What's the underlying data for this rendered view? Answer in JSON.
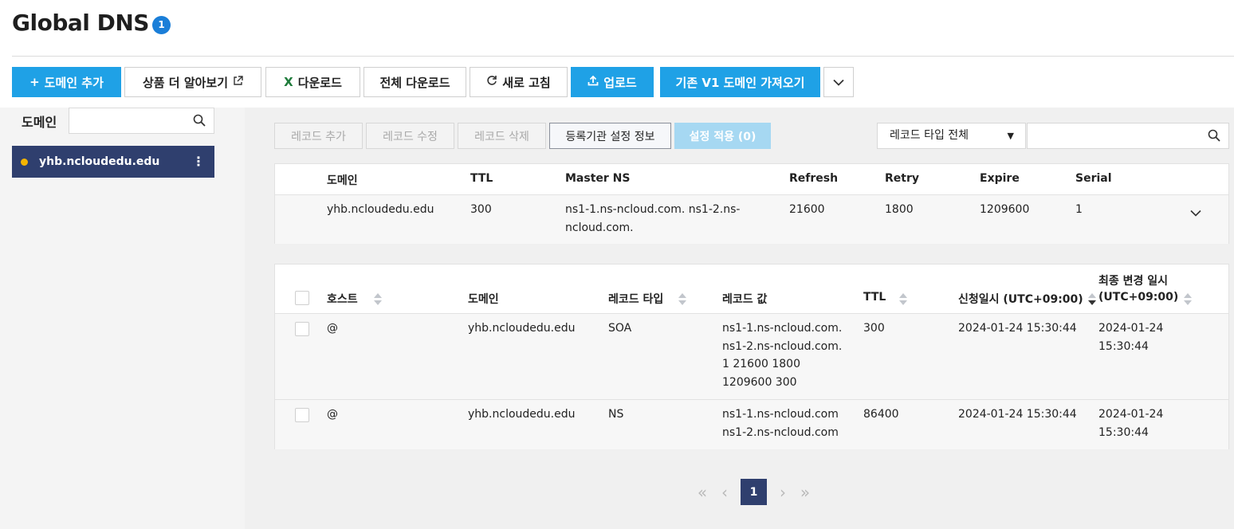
{
  "header": {
    "title": "Global DNS",
    "badge": "1"
  },
  "toolbar": {
    "add_domain": "도메인 추가",
    "learn_more": "상품 더 알아보기",
    "download": "다운로드",
    "download_all": "전체 다운로드",
    "refresh": "새로 고침",
    "upload": "업로드",
    "import_v1": "기존 V1 도메인 가져오기"
  },
  "sidebar": {
    "label": "도메인",
    "search_placeholder": "",
    "items": [
      {
        "label": "yhb.ncloudedu.edu"
      }
    ]
  },
  "records_toolbar": {
    "add": "레코드 추가",
    "edit": "레코드 수정",
    "delete": "레코드 삭제",
    "registrar": "등록기관 설정 정보",
    "apply": "설정 적용 (0)",
    "type_filter": "레코드 타입 전체",
    "search_placeholder": ""
  },
  "soa": {
    "headers": [
      "도메인",
      "TTL",
      "Master NS",
      "Refresh",
      "Retry",
      "Expire",
      "Serial"
    ],
    "row": {
      "domain": "yhb.ncloudedu.edu",
      "ttl": "300",
      "master_ns_1": "ns1-1.ns-ncloud.com. ns1-2.ns-",
      "master_ns_2": "ncloud.com.",
      "refresh": "21600",
      "retry": "1800",
      "expire": "1209600",
      "serial": "1"
    }
  },
  "records": {
    "headers": {
      "host": "호스트",
      "domain": "도메인",
      "type": "레코드 타입",
      "value": "레코드 값",
      "ttl": "TTL",
      "requested": "신청일시 (UTC+09:00)",
      "modified_1": "최종 변경 일시",
      "modified_2": "(UTC+09:00)"
    },
    "rows": [
      {
        "host": "@",
        "domain": "yhb.ncloudedu.edu",
        "type": "SOA",
        "value": [
          "ns1-1.ns-ncloud.com.",
          "ns1-2.ns-ncloud.com.",
          "1 21600 1800",
          "1209600 300"
        ],
        "ttl": "300",
        "requested": "2024-01-24 15:30:44",
        "modified": [
          "2024-01-24",
          "15:30:44"
        ]
      },
      {
        "host": "@",
        "domain": "yhb.ncloudedu.edu",
        "type": "NS",
        "value": [
          "ns1-1.ns-ncloud.com",
          "ns1-2.ns-ncloud.com"
        ],
        "ttl": "86400",
        "requested": "2024-01-24 15:30:44",
        "modified": [
          "2024-01-24",
          "15:30:44"
        ]
      }
    ]
  },
  "pagination": {
    "current": "1"
  },
  "colors": {
    "primary": "#1fa1e6",
    "navy": "#2f3f6e",
    "badge": "#1a7ed8",
    "dot": "#f4b400"
  }
}
